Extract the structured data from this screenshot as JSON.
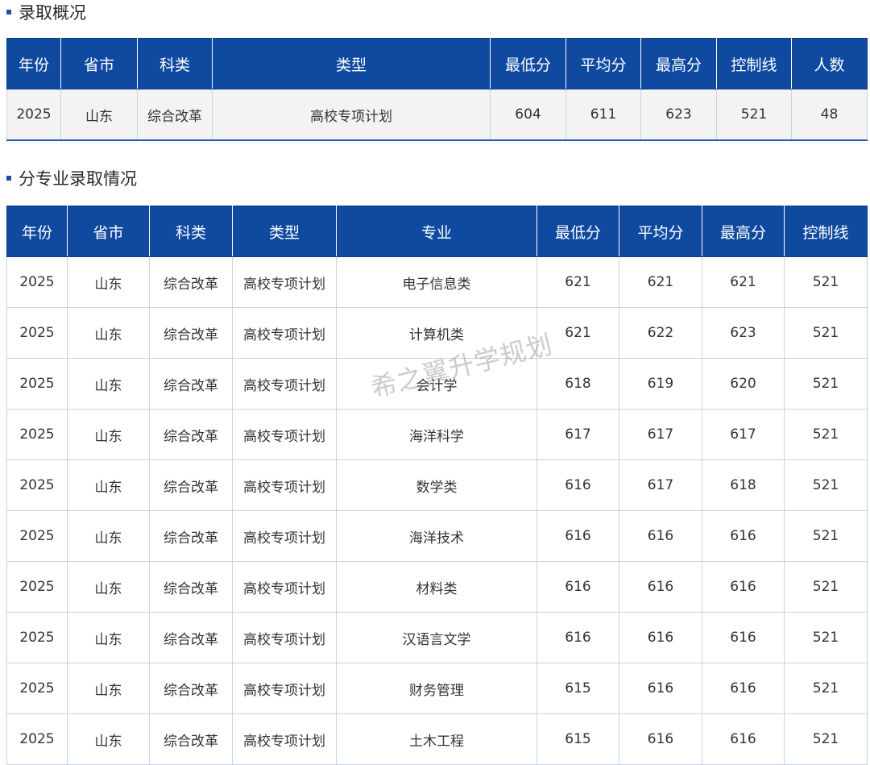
{
  "overview": {
    "title": "录取概况",
    "headers": [
      "年份",
      "省市",
      "科类",
      "类型",
      "最低分",
      "平均分",
      "最高分",
      "控制线",
      "人数"
    ],
    "rows": [
      [
        "2025",
        "山东",
        "综合改革",
        "高校专项计划",
        "604",
        "611",
        "623",
        "521",
        "48"
      ]
    ]
  },
  "majors": {
    "title": "分专业录取情况",
    "headers": [
      "年份",
      "省市",
      "科类",
      "类型",
      "专业",
      "最低分",
      "平均分",
      "最高分",
      "控制线"
    ],
    "rows": [
      [
        "2025",
        "山东",
        "综合改革",
        "高校专项计划",
        "电子信息类",
        "621",
        "621",
        "621",
        "521"
      ],
      [
        "2025",
        "山东",
        "综合改革",
        "高校专项计划",
        "计算机类",
        "621",
        "622",
        "623",
        "521"
      ],
      [
        "2025",
        "山东",
        "综合改革",
        "高校专项计划",
        "会计学",
        "618",
        "619",
        "620",
        "521"
      ],
      [
        "2025",
        "山东",
        "综合改革",
        "高校专项计划",
        "海洋科学",
        "617",
        "617",
        "617",
        "521"
      ],
      [
        "2025",
        "山东",
        "综合改革",
        "高校专项计划",
        "数学类",
        "616",
        "617",
        "618",
        "521"
      ],
      [
        "2025",
        "山东",
        "综合改革",
        "高校专项计划",
        "海洋技术",
        "616",
        "616",
        "616",
        "521"
      ],
      [
        "2025",
        "山东",
        "综合改革",
        "高校专项计划",
        "材料类",
        "616",
        "616",
        "616",
        "521"
      ],
      [
        "2025",
        "山东",
        "综合改革",
        "高校专项计划",
        "汉语言文学",
        "616",
        "616",
        "616",
        "521"
      ],
      [
        "2025",
        "山东",
        "综合改革",
        "高校专项计划",
        "财务管理",
        "615",
        "616",
        "616",
        "521"
      ],
      [
        "2025",
        "山东",
        "综合改革",
        "高校专项计划",
        "土木工程",
        "615",
        "616",
        "616",
        "521"
      ]
    ]
  },
  "watermark": "希之翼升学规划"
}
